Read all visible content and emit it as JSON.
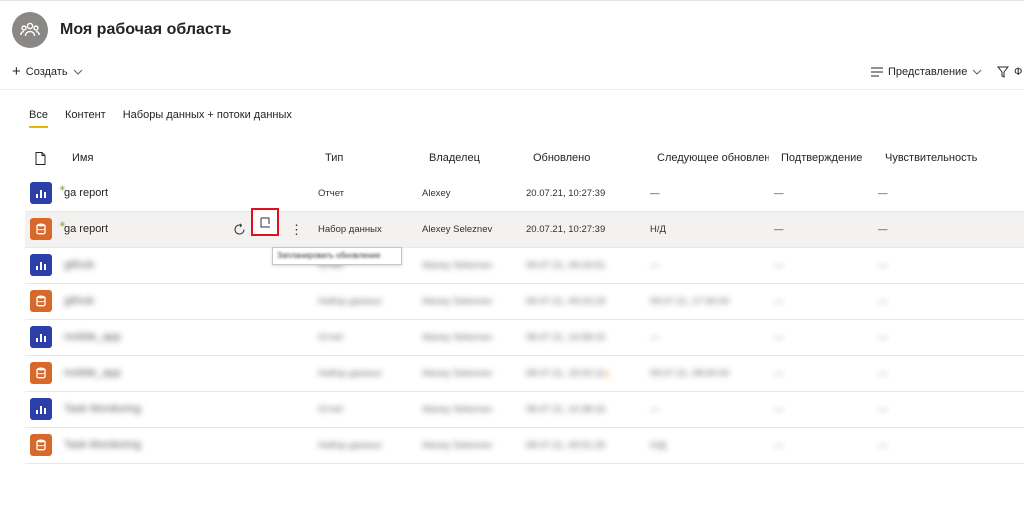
{
  "workspace": {
    "title": "Моя рабочая область",
    "icon": "people-group-icon"
  },
  "toolbar": {
    "create_label": "Создать",
    "view_label": "Представление",
    "filter_label": "Ф"
  },
  "tabs": [
    {
      "label": "Все",
      "active": true
    },
    {
      "label": "Контент",
      "active": false
    },
    {
      "label": "Наборы данных + потоки данных",
      "active": false
    }
  ],
  "columns": {
    "name": "Имя",
    "type": "Тип",
    "owner": "Владелец",
    "updated": "Обновлено",
    "next_refresh": "Следующее обновление",
    "endorsement": "Подтверждение",
    "sensitivity": "Чувствительность"
  },
  "rows": [
    {
      "kind": "report",
      "name": "ga report",
      "type": "Отчет",
      "owner": "Alexey",
      "updated": "20.07.21, 10:27:39",
      "next_refresh": "—",
      "endorsement": "—",
      "sensitivity": "—"
    },
    {
      "kind": "dataset",
      "name": "ga report",
      "type": "Набор данных",
      "owner": "Alexey Seleznev",
      "updated": "20.07.21, 10:27:39",
      "next_refresh": "Н/Д",
      "endorsement": "—",
      "sensitivity": "—"
    },
    {
      "kind": "report",
      "name": "github",
      "type": "Отчет",
      "owner": "Alexey Seleznev",
      "updated": "09.07.21, 09:24:51",
      "next_refresh": "—",
      "endorsement": "—",
      "sensitivity": "—"
    },
    {
      "kind": "dataset",
      "name": "github",
      "type": "Набор данных",
      "owner": "Alexey Seleznev",
      "updated": "09.07.21, 09:23:19",
      "next_refresh": "09.07.21, 17:30:00",
      "endorsement": "—",
      "sensitivity": "—"
    },
    {
      "kind": "report",
      "name": "mobile_app",
      "type": "Отчет",
      "owner": "Alexey Seleznev",
      "updated": "08.07.21, 14:58:15",
      "next_refresh": "—",
      "endorsement": "—",
      "sensitivity": "—"
    },
    {
      "kind": "dataset",
      "name": "mobile_app",
      "type": "Набор данных",
      "owner": "Alexey Seleznev",
      "updated": "08.07.21, 15:02:11",
      "next_refresh": "09.07.21, 08:00:00",
      "endorsement": "—",
      "sensitivity": "—"
    },
    {
      "kind": "report",
      "name": "Task Monitoring",
      "type": "Отчет",
      "owner": "Alexey Seleznev",
      "updated": "08.07.21, 10:38:16",
      "next_refresh": "—",
      "endorsement": "—",
      "sensitivity": "—"
    },
    {
      "kind": "dataset",
      "name": "Task Monitoring",
      "type": "Набор данных",
      "owner": "Alexey Seleznev",
      "updated": "08.07.21, 09:51:25",
      "next_refresh": "Н/Д",
      "endorsement": "—",
      "sensitivity": "—"
    }
  ],
  "tooltip": {
    "text": "Запланировать обновление"
  },
  "colors": {
    "report": "#2b3fa8",
    "dataset": "#d8692a",
    "highlight": "#e0101d",
    "tab_underline": "#e8b600"
  }
}
